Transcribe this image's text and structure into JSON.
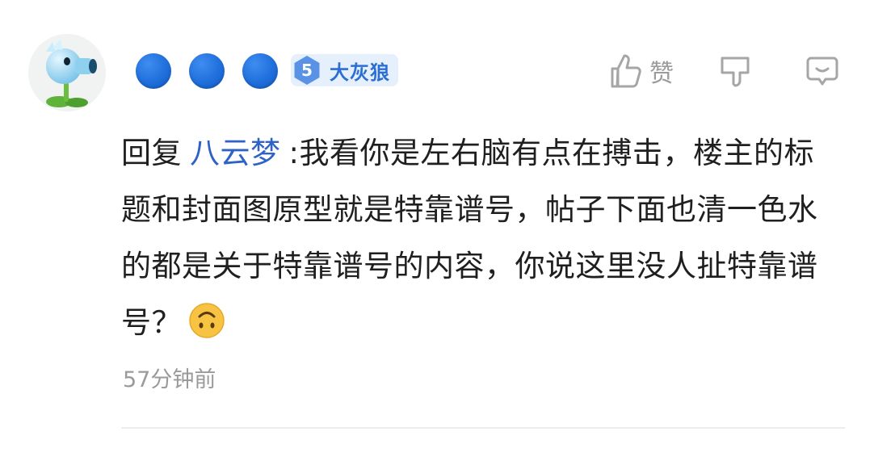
{
  "user": {
    "avatar_icon": "peashooter-plant-avatar",
    "nickname_display": "masked-blue-dots",
    "level": {
      "number": "5",
      "title": "大灰狼"
    }
  },
  "actions": {
    "like_icon": "thumbs-up-icon",
    "like_label": "赞",
    "dislike_icon": "thumbs-down-icon",
    "reply_icon": "comment-reply-icon"
  },
  "comment": {
    "reply_prefix": "回复",
    "reply_to_user": "八云梦",
    "text": ":我看你是左右脑有点在搏击，楼主的标题和封面图原型就是特靠谱号，帖子下面也清一色水的都是关于特靠谱号的内容，你说这里没人扯特靠谱号？",
    "emoji": "upside-down-face-emoji"
  },
  "timestamp": "57分钟前",
  "colors": {
    "link_blue": "#2f62c7",
    "badge_bg": "#e6f0fd",
    "badge_text": "#2c6fd4",
    "muted_gray": "#9a9a9a"
  }
}
